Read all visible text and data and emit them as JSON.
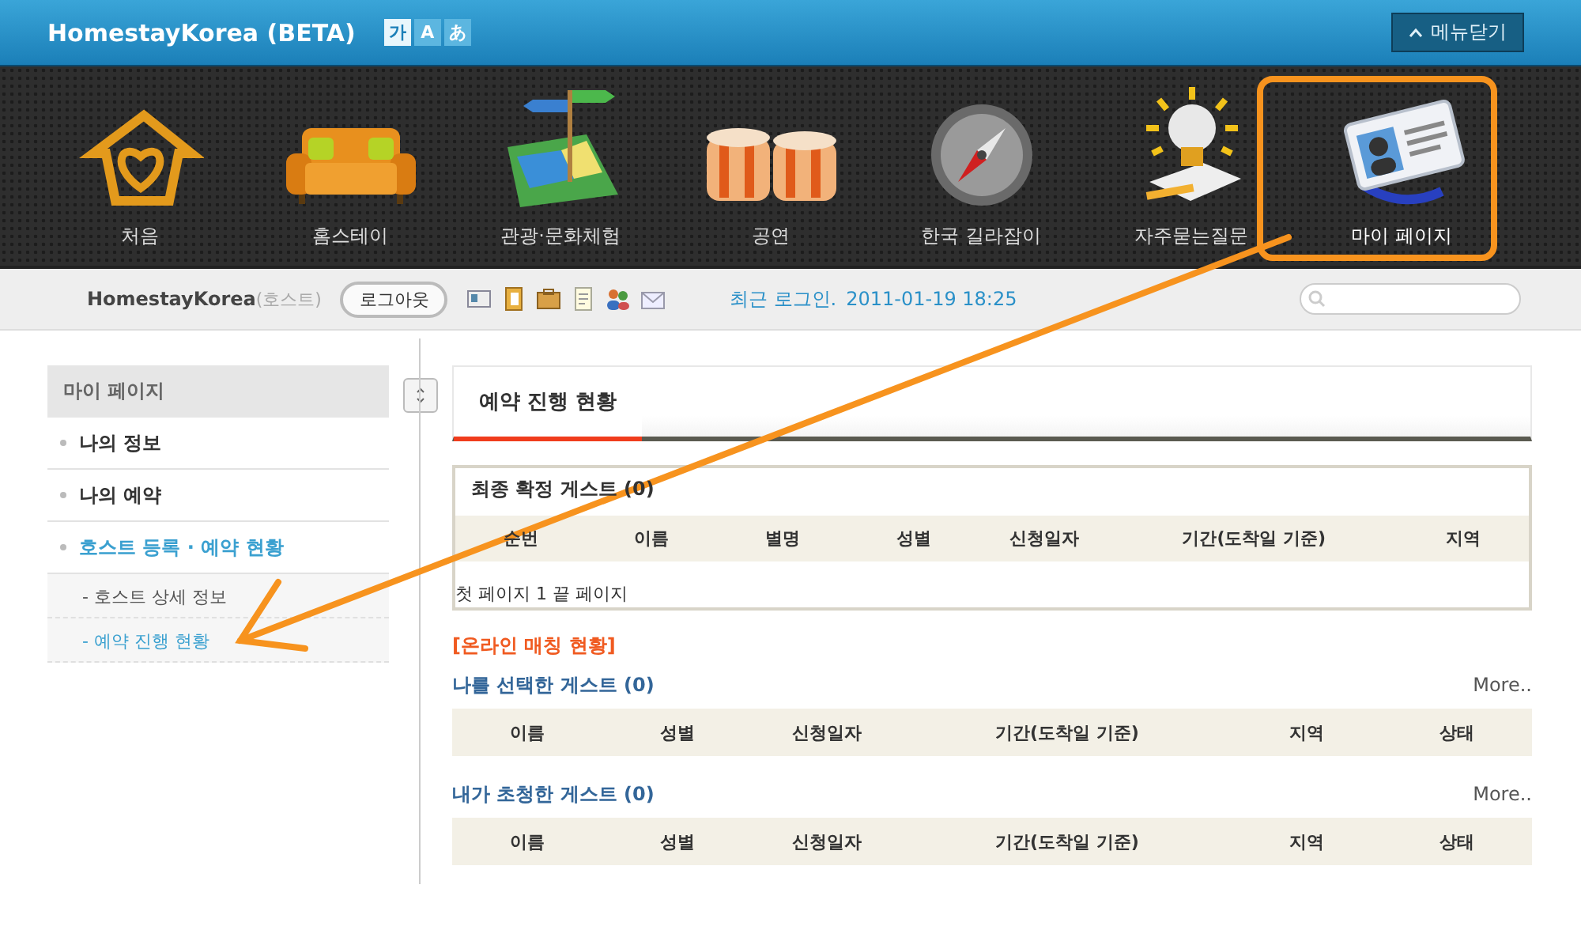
{
  "header": {
    "title": "HomestayKorea (BETA)",
    "languages": [
      {
        "label": "가",
        "selected": true
      },
      {
        "label": "A",
        "selected": false
      },
      {
        "label": "あ",
        "selected": false
      }
    ],
    "close_menu": "메뉴닫기"
  },
  "nav": [
    {
      "label": "처음",
      "kind": "house",
      "selected": false
    },
    {
      "label": "홈스테이",
      "kind": "sofa",
      "selected": false
    },
    {
      "label": "관광·문화체험",
      "kind": "map",
      "selected": false
    },
    {
      "label": "공연",
      "kind": "drums",
      "selected": false
    },
    {
      "label": "한국 길라잡이",
      "kind": "compass",
      "selected": false
    },
    {
      "label": "자주묻는질문",
      "kind": "bulb",
      "selected": false
    },
    {
      "label": "마이 페이지",
      "kind": "card",
      "selected": true
    }
  ],
  "userbar": {
    "user": "HomestayKorea",
    "role": "(호스트)",
    "logout": "로그아웃",
    "last_login_label": "최근 로그인.",
    "last_login": "2011-01-19 18:25"
  },
  "sidebar": {
    "title": "마이 페이지",
    "items": [
      {
        "label": "나의 정보",
        "selected": false
      },
      {
        "label": "나의 예약",
        "selected": false
      },
      {
        "label": "호스트 등록 · 예약 현황",
        "selected": true,
        "children": [
          {
            "label": "- 호스트 상세 정보",
            "selected": false
          },
          {
            "label": "- 예약 진행 현황",
            "selected": true
          }
        ]
      }
    ]
  },
  "main": {
    "tabs": [
      {
        "label": "예약 진행 현황",
        "selected": true
      }
    ],
    "confirmed": {
      "title": "최종 확정 게스트 (0)",
      "columns": [
        "순번",
        "이름",
        "별명",
        "성별",
        "신청일자",
        "기간(도착일 기준)",
        "지역"
      ],
      "pager": "첫 페이지 1 끝 페이지"
    },
    "matching_title": "[온라인 매칭 현황]",
    "sections": [
      {
        "title": "나를 선택한 게스트 (0)",
        "more": "More..",
        "columns": [
          "이름",
          "성별",
          "신청일자",
          "기간(도착일 기준)",
          "지역",
          "상태"
        ]
      },
      {
        "title": "내가 초청한 게스트 (0)",
        "more": "More..",
        "columns": [
          "이름",
          "성별",
          "신청일자",
          "기간(도착일 기준)",
          "지역",
          "상태"
        ]
      }
    ]
  }
}
